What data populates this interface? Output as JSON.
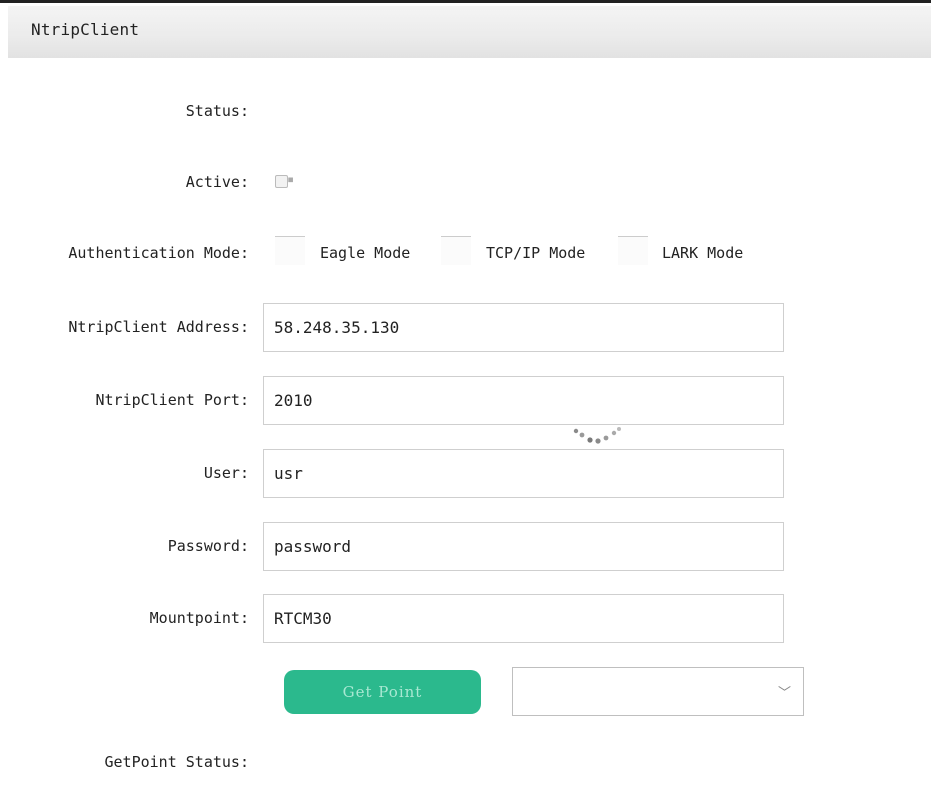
{
  "header": {
    "title": "NtripClient"
  },
  "form": {
    "status_label": "Status:",
    "status_value": "",
    "active_label": "Active:",
    "active_checked": true,
    "auth_mode_label": "Authentication Mode:",
    "auth_modes": [
      "Eagle Mode",
      "TCP/IP Mode",
      "LARK Mode"
    ],
    "address_label": "NtripClient Address:",
    "address_value": "58.248.35.130",
    "port_label": "NtripClient Port:",
    "port_value": "2010",
    "user_label": "User:",
    "user_value": "usr",
    "password_label": "Password:",
    "password_value": "password",
    "mountpoint_label": "Mountpoint:",
    "mountpoint_value": "RTCM30",
    "get_point_button": "Get Point",
    "mountpoint_select_value": "",
    "getpoint_status_label": "GetPoint Status:",
    "getpoint_status_value": ""
  },
  "icons": {
    "select_chevron": "chevron-down-icon",
    "loading": "loading-spinner-icon"
  },
  "colors": {
    "primary_button": "#2bb98d",
    "header_bg": "#ebebeb"
  }
}
